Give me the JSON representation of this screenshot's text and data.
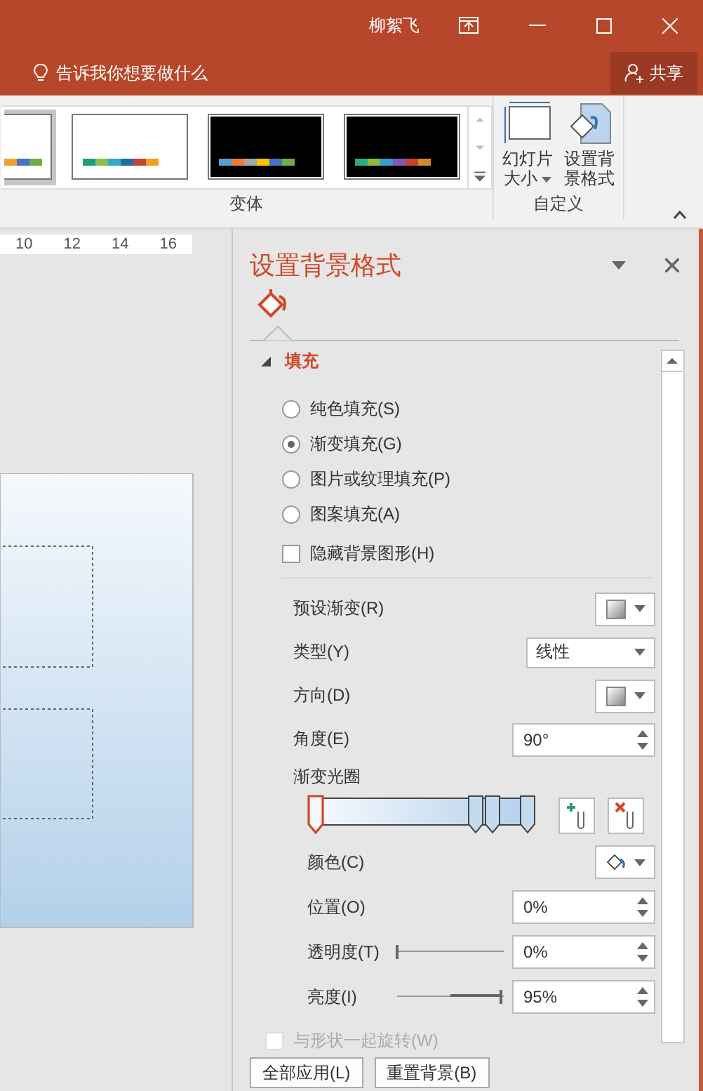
{
  "title_bar": {
    "user": "柳絮飞"
  },
  "tell_me": {
    "placeholder": "告诉我你想要做什么"
  },
  "share_button": "共享",
  "ribbon": {
    "variants": [
      {
        "selected": true,
        "dark": false,
        "swatches": [
          {
            "color": "#f0a030"
          },
          {
            "color": "#4472c4"
          },
          {
            "color": "#70ad47"
          }
        ]
      },
      {
        "selected": false,
        "dark": false,
        "swatches": [
          {
            "color": "#1e9b78"
          },
          {
            "color": "#8cc04b"
          },
          {
            "color": "#34a9c9"
          },
          {
            "color": "#1f6fa6"
          },
          {
            "color": "#c0462a"
          },
          {
            "color": "#f0a020"
          }
        ]
      },
      {
        "selected": false,
        "dark": true,
        "swatches": [
          {
            "color": "#5b9bd5"
          },
          {
            "color": "#ed7d31"
          },
          {
            "color": "#a5a5a5"
          },
          {
            "color": "#ffc000"
          },
          {
            "color": "#4472c4"
          },
          {
            "color": "#70ad47"
          }
        ]
      },
      {
        "selected": false,
        "dark": true,
        "swatches": [
          {
            "color": "#2eab82"
          },
          {
            "color": "#8cba3f"
          },
          {
            "color": "#3a9cc8"
          },
          {
            "color": "#7e57c2"
          },
          {
            "color": "#c8452a"
          },
          {
            "color": "#d48a2a"
          }
        ]
      }
    ],
    "variants_group": "变体",
    "custom_buttons": [
      {
        "kind": "slide-size",
        "label": "幻灯片大小"
      },
      {
        "kind": "background",
        "label": "设置背景格式"
      }
    ],
    "custom_group": "自定义"
  },
  "ruler": [
    "10",
    "12",
    "14",
    "16"
  ],
  "format_pane": {
    "title": "设置背景格式",
    "section": {
      "title": "填充",
      "expanded": true
    },
    "fill_options": [
      {
        "label": "纯色填充(S)",
        "selected": false
      },
      {
        "label": "渐变填充(G)",
        "selected": true
      },
      {
        "label": "图片或纹理填充(P)",
        "selected": false
      },
      {
        "label": "图案填充(A)",
        "selected": false
      }
    ],
    "hide_background": {
      "label": "隐藏背景图形(H)",
      "checked": false
    },
    "settings": [
      {
        "kind": "swatch",
        "label": "预设渐变(R)"
      },
      {
        "kind": "dropdown",
        "label": "类型(Y)",
        "value": "线性"
      },
      {
        "kind": "swatch",
        "label": "方向(D)"
      },
      {
        "kind": "spinner",
        "label": "角度(E)",
        "value": "90°"
      }
    ],
    "gradient_stops": {
      "label": "渐变光圈",
      "stops": [
        {
          "level": 0,
          "selected": true
        },
        {
          "level": 0.74,
          "selected": false
        },
        {
          "level": 0.82,
          "selected": false
        },
        {
          "level": 0.98,
          "selected": false
        }
      ]
    },
    "stop_settings": [
      {
        "kind": "color",
        "label": "颜色(C)"
      },
      {
        "kind": "spinner",
        "label": "位置(O)",
        "value": "0%"
      },
      {
        "kind": "slider",
        "label": "透明度(T)",
        "value": "0%",
        "level": 0
      },
      {
        "kind": "slider",
        "label": "亮度(I)",
        "value": "95%",
        "level": 0.97
      }
    ],
    "rotate_with_shape": {
      "label": "与形状一起旋转(W)",
      "checked": false,
      "disabled": true
    },
    "buttons": [
      "全部应用(L)",
      "重置背景(B)"
    ]
  }
}
